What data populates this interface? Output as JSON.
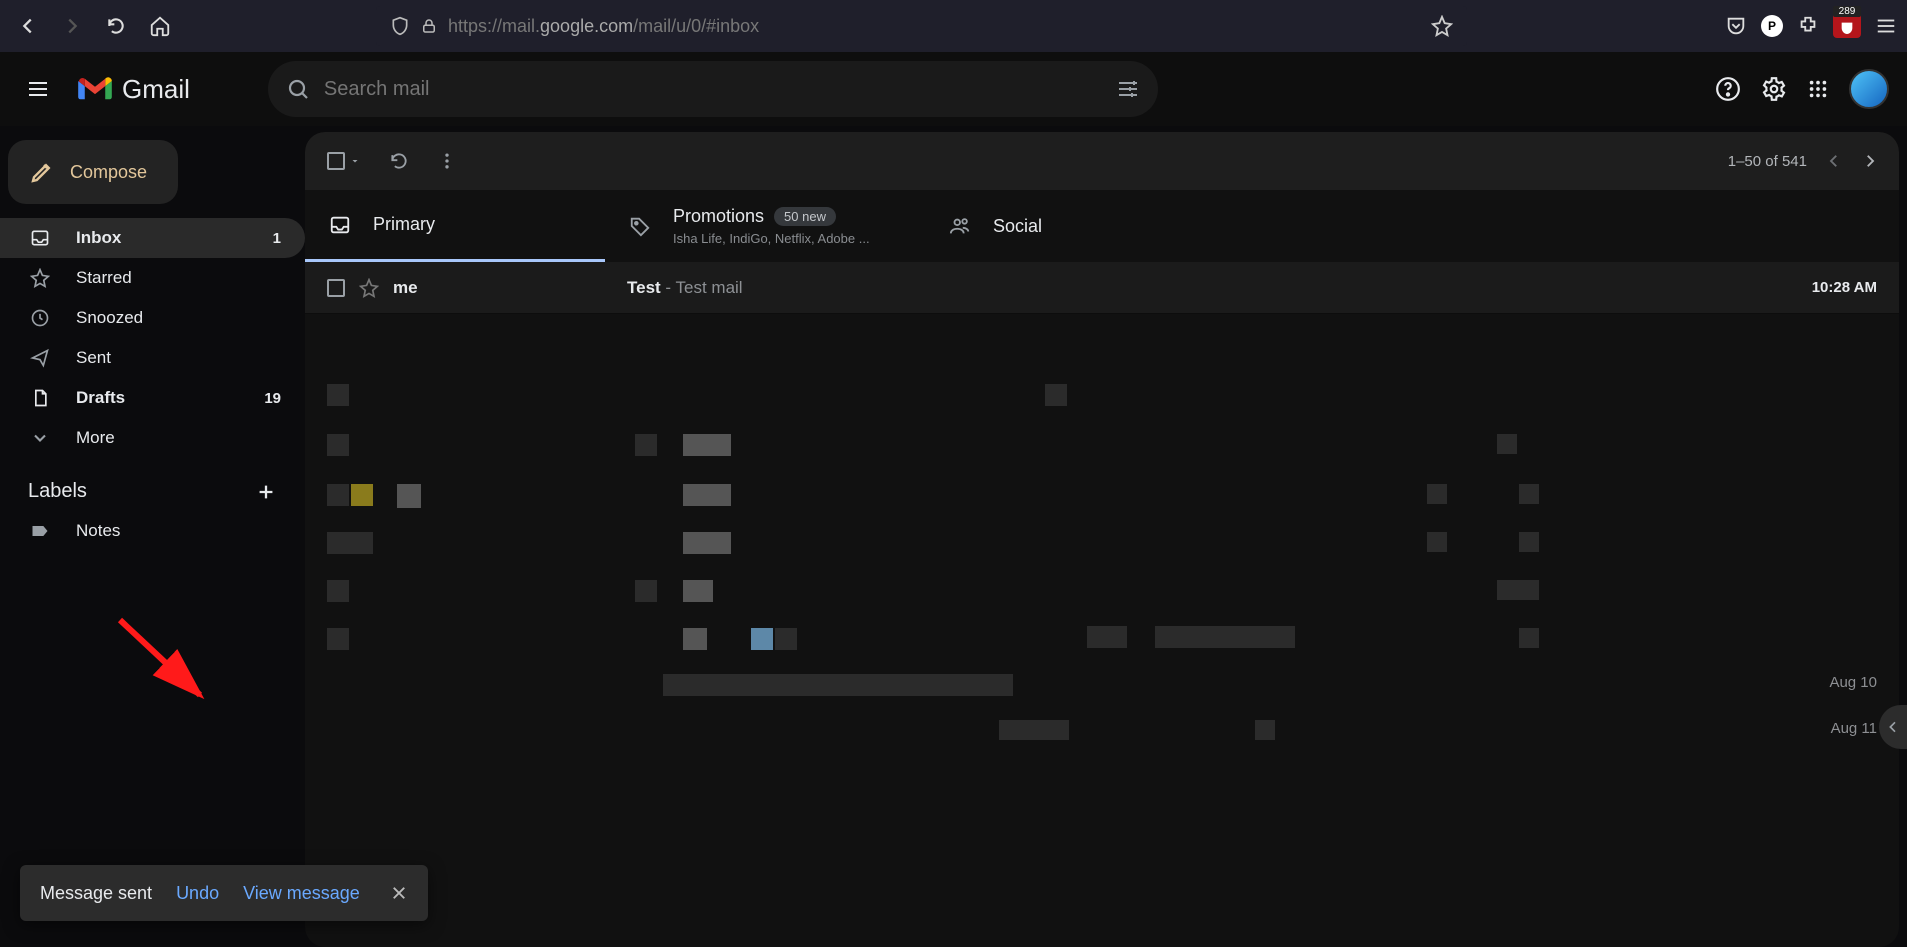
{
  "browser": {
    "url_prefix": "https://mail.",
    "url_mid": "google.com",
    "url_suffix": "/mail/u/0/#inbox",
    "ext_count": "289"
  },
  "header": {
    "app_name": "Gmail",
    "search_placeholder": "Search mail"
  },
  "compose": {
    "label": "Compose"
  },
  "nav": {
    "inbox": {
      "label": "Inbox",
      "count": "1"
    },
    "starred": {
      "label": "Starred"
    },
    "snoozed": {
      "label": "Snoozed"
    },
    "sent": {
      "label": "Sent"
    },
    "drafts": {
      "label": "Drafts",
      "count": "19"
    },
    "more": {
      "label": "More"
    }
  },
  "labels": {
    "header": "Labels",
    "notes": "Notes"
  },
  "toolbar": {
    "paging": "1–50 of 541"
  },
  "tabs": {
    "primary": {
      "title": "Primary"
    },
    "promotions": {
      "title": "Promotions",
      "badge": "50 new",
      "sub": "Isha Life, IndiGo, Netflix, Adobe ..."
    },
    "social": {
      "title": "Social"
    }
  },
  "mail": {
    "row1": {
      "from": "me",
      "subject": "Test",
      "sep": " - ",
      "snippet": "Test mail",
      "time": "10:28 AM"
    }
  },
  "blurred_dates": {
    "d1": "Aug 10",
    "d2": "Aug 11"
  },
  "toast": {
    "text": "Message sent",
    "undo": "Undo",
    "view": "View message"
  }
}
